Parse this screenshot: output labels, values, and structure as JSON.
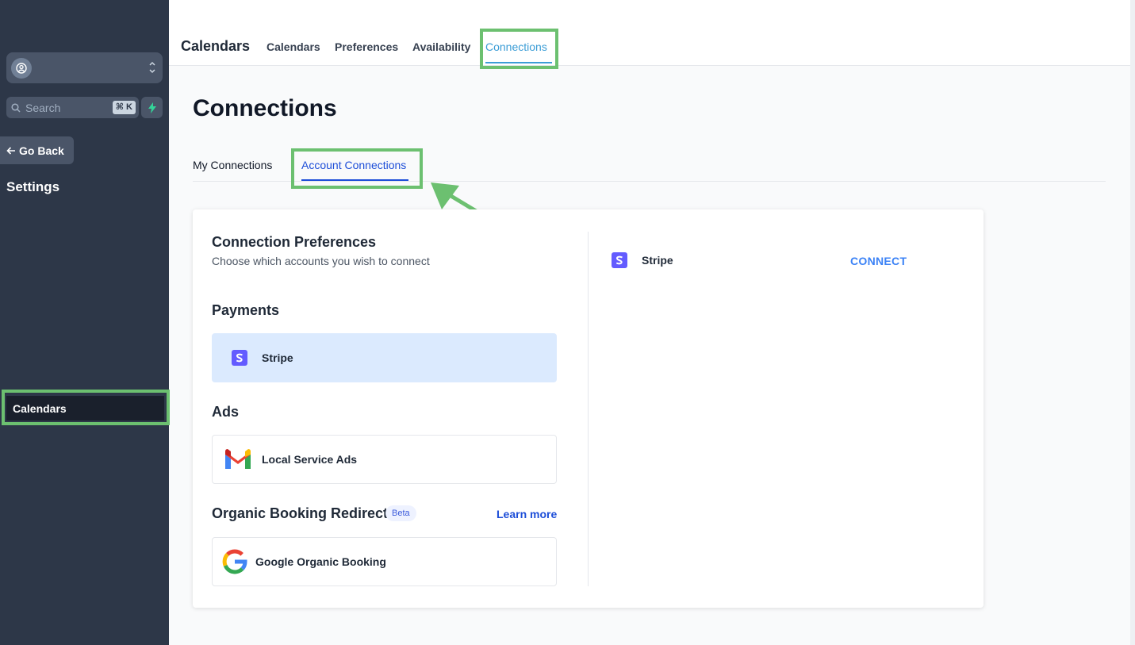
{
  "sidebar": {
    "search_placeholder": "Search",
    "search_shortcut": "⌘ K",
    "go_back_label": "Go Back",
    "section_title": "Settings",
    "active_item_label": "Calendars"
  },
  "topnav": {
    "title": "Calendars",
    "tabs": [
      {
        "label": "Calendars"
      },
      {
        "label": "Preferences"
      },
      {
        "label": "Availability"
      },
      {
        "label": "Connections"
      }
    ]
  },
  "main": {
    "page_title": "Connections",
    "subtabs": [
      {
        "label": "My Connections"
      },
      {
        "label": "Account Connections"
      }
    ]
  },
  "card": {
    "title": "Connection Preferences",
    "subtitle": "Choose which accounts you wish to connect",
    "sections": {
      "payments": {
        "heading": "Payments",
        "item_label": "Stripe"
      },
      "ads": {
        "heading": "Ads",
        "item_label": "Local Service Ads"
      },
      "organic": {
        "heading": "Organic Booking Redirect",
        "badge": "Beta",
        "learn_more": "Learn more",
        "item_label": "Google Organic Booking"
      }
    },
    "detail": {
      "provider": "Stripe",
      "connect_label": "CONNECT"
    }
  },
  "colors": {
    "sidebar_bg": "#2d3748",
    "accent_blue": "#1d4ed8",
    "highlight_green": "#6cc070",
    "stripe_purple": "#635bff"
  }
}
